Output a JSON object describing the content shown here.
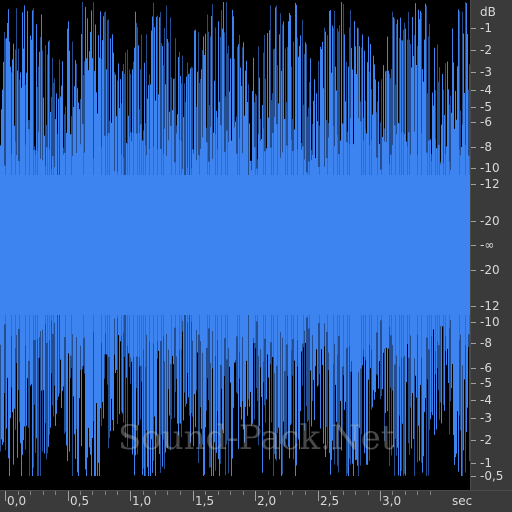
{
  "colors": {
    "waveform": "#3d84f0",
    "background": "#000000",
    "ruler_background": "#3a3a3a",
    "ruler_text": "#d8d8d8"
  },
  "db_scale": {
    "unit_label": "dB",
    "marks": [
      {
        "label": "-1",
        "level": 0.891
      },
      {
        "label": "-2",
        "level": 0.794
      },
      {
        "label": "-3",
        "level": 0.708
      },
      {
        "label": "-4",
        "level": 0.631
      },
      {
        "label": "-5",
        "level": 0.562
      },
      {
        "label": "-6",
        "level": 0.501
      },
      {
        "label": "-8",
        "level": 0.398
      },
      {
        "label": "-10",
        "level": 0.316
      },
      {
        "label": "-12",
        "level": 0.251
      },
      {
        "label": "-20",
        "level": 0.1
      },
      {
        "label": "-∞",
        "level": 0
      },
      {
        "label": "-20",
        "level": -0.1
      },
      {
        "label": "-12",
        "level": -0.251
      },
      {
        "label": "-10",
        "level": -0.316
      },
      {
        "label": "-8",
        "level": -0.398
      },
      {
        "label": "-6",
        "level": -0.501
      },
      {
        "label": "-5",
        "level": -0.562
      },
      {
        "label": "-4",
        "level": -0.631
      },
      {
        "label": "-3",
        "level": -0.708
      },
      {
        "label": "-2",
        "level": -0.794
      },
      {
        "label": "-1",
        "level": -0.891
      },
      {
        "label": "-0,5",
        "level": -0.944
      }
    ]
  },
  "time_scale": {
    "unit_label": "sec",
    "range_seconds": [
      0,
      3.72
    ],
    "marks": [
      {
        "label": "0,0",
        "seconds": 0.0
      },
      {
        "label": "0,5",
        "seconds": 0.5
      },
      {
        "label": "1,0",
        "seconds": 1.0
      },
      {
        "label": "1,5",
        "seconds": 1.5
      },
      {
        "label": "2,0",
        "seconds": 2.0
      },
      {
        "label": "2,5",
        "seconds": 2.5
      },
      {
        "label": "3,0",
        "seconds": 3.0
      }
    ]
  },
  "watermark": "Sound-Pack.Net"
}
